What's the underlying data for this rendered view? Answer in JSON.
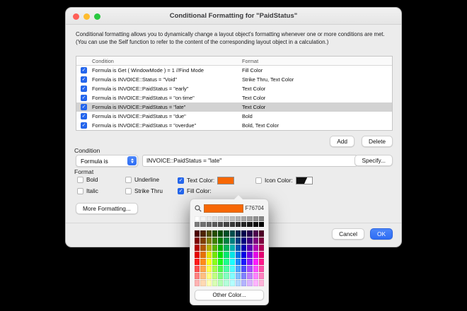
{
  "window": {
    "title": "Conditional Formatting for \"PaidStatus\"",
    "description": "Conditional formatting allows you to dynamically change a layout object's formatting whenever one or more conditions are met.  (You can use the Self function to refer to the content of the corresponding layout object in a calculation.)"
  },
  "table": {
    "headers": {
      "condition": "Condition",
      "format": "Format"
    },
    "rows": [
      {
        "checked": true,
        "selected": false,
        "condition": "Formula is Get ( WindowMode ) = 1 //Find Mode",
        "format": "Fill Color"
      },
      {
        "checked": true,
        "selected": false,
        "condition": "Formula is INVOICE::Status = \"Void\"",
        "format": "Strike Thru, Text Color"
      },
      {
        "checked": true,
        "selected": false,
        "condition": "Formula is INVOICE::PaidStatus = \"early\"",
        "format": "Text Color"
      },
      {
        "checked": true,
        "selected": false,
        "condition": "Formula is INVOICE::PaidStatus = \"on time\"",
        "format": "Text Color"
      },
      {
        "checked": true,
        "selected": true,
        "condition": "Formula is INVOICE::PaidStatus = \"late\"",
        "format": "Text Color"
      },
      {
        "checked": true,
        "selected": false,
        "condition": "Formula is INVOICE::PaidStatus = \"due\"",
        "format": "Bold"
      },
      {
        "checked": true,
        "selected": false,
        "condition": "Formula is INVOICE::PaidStatus = \"overdue\"",
        "format": "Bold, Text Color"
      }
    ]
  },
  "buttons": {
    "add": "Add",
    "delete": "Delete",
    "specify": "Specify...",
    "more_formatting": "More Formatting...",
    "cancel": "Cancel",
    "ok": "OK",
    "other_color": "Other Color..."
  },
  "condition_section": {
    "label": "Condition",
    "popup_value": "Formula is",
    "formula": "INVOICE::PaidStatus = \"late\""
  },
  "format_section": {
    "label": "Format",
    "checkboxes": [
      {
        "label": "Bold",
        "checked": false
      },
      {
        "label": "Italic",
        "checked": false
      },
      {
        "label": "Underline",
        "checked": false
      },
      {
        "label": "Strike Thru",
        "checked": false
      },
      {
        "label": "Text Color:",
        "checked": true
      },
      {
        "label": "Fill Color:",
        "checked": true
      },
      {
        "label": "Icon Color:",
        "checked": false
      }
    ],
    "text_color_swatch": "#F76704"
  },
  "color_picker": {
    "hex": "F76704",
    "selected_color": "#F76704",
    "grayscale": [
      [
        "#FFFFFF",
        "#F4F4F4",
        "#E9E9E9",
        "#DEDEDE",
        "#D3D3D3",
        "#C8C8C8",
        "#BDBDBD",
        "#B2B2B2",
        "#A7A7A7",
        "#9C9C9C",
        "#919191",
        "#868686"
      ],
      [
        "#7B7B7B",
        "#707070",
        "#656565",
        "#5A5A5A",
        "#4F4F4F",
        "#444444",
        "#393939",
        "#2E2E2E",
        "#232323",
        "#181818",
        "#0D0D0D",
        "#000000"
      ]
    ],
    "spectrum": [
      [
        "#4D0000",
        "#4D2600",
        "#4D4D00",
        "#264D00",
        "#004D00",
        "#004D26",
        "#004D4D",
        "#00264D",
        "#00004D",
        "#26004D",
        "#4D004D",
        "#4D0026"
      ],
      [
        "#800000",
        "#804000",
        "#808000",
        "#408000",
        "#008000",
        "#008040",
        "#008080",
        "#004080",
        "#000080",
        "#400080",
        "#800080",
        "#800040"
      ],
      [
        "#B30000",
        "#B35900",
        "#B3B300",
        "#59B300",
        "#00B300",
        "#00B359",
        "#00B3B3",
        "#0059B3",
        "#0000B3",
        "#5900B3",
        "#B300B3",
        "#B30059"
      ],
      [
        "#E60000",
        "#E67300",
        "#E6E600",
        "#73E600",
        "#00E600",
        "#00E673",
        "#00E6E6",
        "#0073E6",
        "#0000E6",
        "#7300E6",
        "#E600E6",
        "#E60073"
      ],
      [
        "#FF1A1A",
        "#FF8C1A",
        "#FFFF1A",
        "#8CFF1A",
        "#1AFF1A",
        "#1AFF8C",
        "#1AFFFF",
        "#1A8CFF",
        "#1A1AFF",
        "#8C1AFF",
        "#FF1AFF",
        "#FF1A8C"
      ],
      [
        "#FF4D4D",
        "#FFA64D",
        "#FFFF4D",
        "#A6FF4D",
        "#4DFF4D",
        "#4DFFA6",
        "#4DFFFF",
        "#4DA6FF",
        "#4D4DFF",
        "#A64DFF",
        "#FF4DFF",
        "#FF4DA6"
      ],
      [
        "#FF8080",
        "#FFBF80",
        "#FFFF80",
        "#BFFF80",
        "#80FF80",
        "#80FFBF",
        "#80FFFF",
        "#80BFFF",
        "#8080FF",
        "#BF80FF",
        "#FF80FF",
        "#FF80BF"
      ],
      [
        "#FFB3B3",
        "#FFD9B3",
        "#FFFFB3",
        "#D9FFB3",
        "#B3FFB3",
        "#B3FFD9",
        "#B3FFFF",
        "#B3D9FF",
        "#B3B3FF",
        "#D9B3FF",
        "#FFB3FF",
        "#FFB3D9"
      ]
    ]
  }
}
